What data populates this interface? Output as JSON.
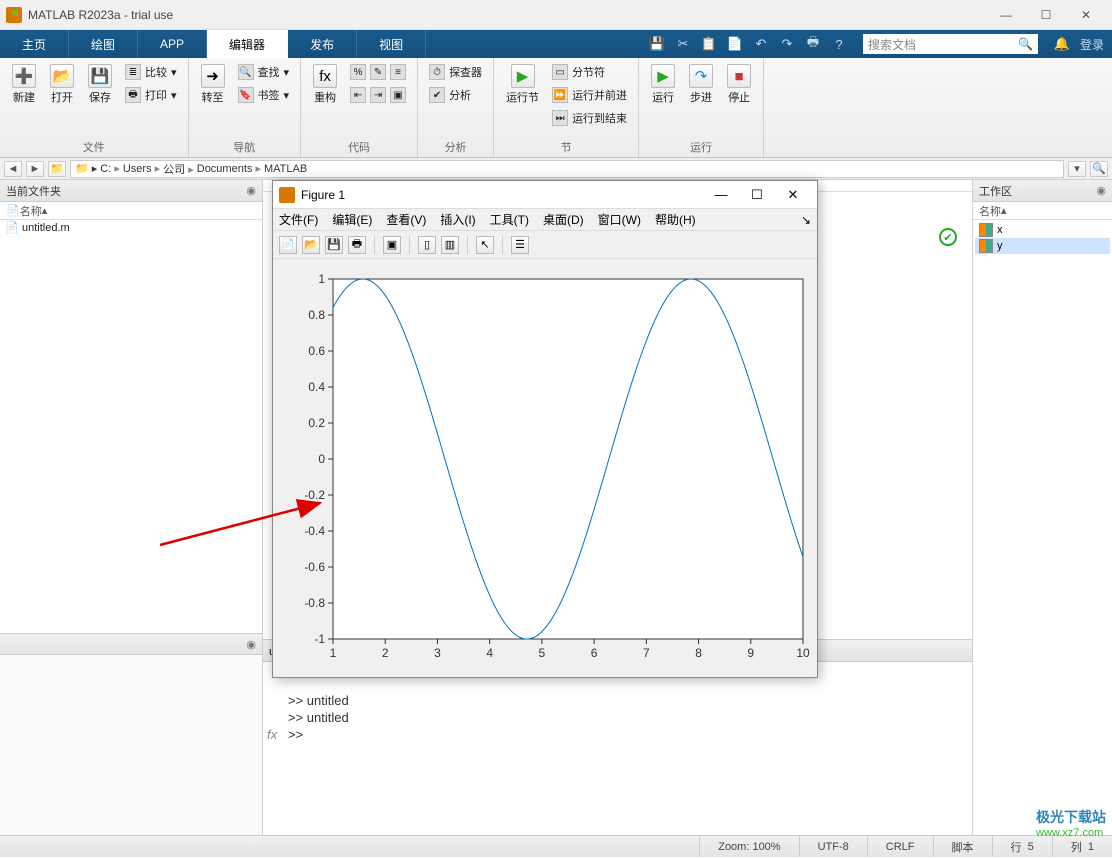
{
  "window": {
    "title": "MATLAB R2023a - trial use"
  },
  "tabs": [
    "主页",
    "绘图",
    "APP",
    "编辑器",
    "发布",
    "视图"
  ],
  "active_tab": 3,
  "qat_search_placeholder": "搜索文档",
  "qat_login": "登录",
  "ribbon": {
    "file": {
      "new": "新建",
      "open": "打开",
      "save": "保存",
      "compare": "比较",
      "print": "打印",
      "label": "文件"
    },
    "nav": {
      "goto": "转至",
      "find": "查找",
      "bookmark": "书签",
      "label": "导航"
    },
    "code": {
      "refactor": "重构",
      "label": "代码"
    },
    "analyze": {
      "explorer": "探查器",
      "analyze": "分析",
      "label": "分析"
    },
    "section": {
      "run": "运行节",
      "sect": "分节符",
      "runadv": "运行并前进",
      "runend": "运行到结束",
      "label": "节"
    },
    "run": {
      "run": "运行",
      "step": "步进",
      "stop": "停止",
      "label": "运行"
    }
  },
  "path": [
    "C:",
    "Users",
    "公司",
    "Documents",
    "MATLAB"
  ],
  "current_folder": {
    "title": "当前文件夹",
    "col": "名称",
    "files": [
      "untitled.m"
    ]
  },
  "editor": {
    "tab": "untitled.m  (脚本)"
  },
  "command": {
    "lines": [
      ">> untitled",
      ">> untitled",
      ">>"
    ]
  },
  "workspace": {
    "title": "工作区",
    "col": "名称",
    "vars": [
      "x",
      "y"
    ]
  },
  "statusbar": {
    "zoom": "Zoom: 100%",
    "enc": "UTF-8",
    "eol": "CRLF",
    "type": "脚本",
    "row": "行",
    "rownum": "5",
    "col": "列",
    "colnum": "1"
  },
  "figure": {
    "title": "Figure 1",
    "menus": [
      "文件(F)",
      "编辑(E)",
      "查看(V)",
      "插入(I)",
      "工具(T)",
      "桌面(D)",
      "窗口(W)",
      "帮助(H)"
    ]
  },
  "chart_data": {
    "type": "line",
    "x": [
      1,
      2,
      3,
      4,
      5,
      6,
      7,
      8,
      9,
      10
    ],
    "y": [
      0.84,
      1.0,
      0.14,
      -0.76,
      -0.96,
      -0.28,
      0.66,
      0.99,
      0.41,
      -0.54
    ],
    "xlim": [
      1,
      10
    ],
    "ylim": [
      -1,
      1
    ],
    "xticks": [
      1,
      2,
      3,
      4,
      5,
      6,
      7,
      8,
      9,
      10
    ],
    "yticks": [
      -1,
      -0.8,
      -0.6,
      -0.4,
      -0.2,
      0,
      0.2,
      0.4,
      0.6,
      0.8,
      1
    ]
  },
  "watermark": {
    "name": "极光下载站",
    "url": "www.xz7.com"
  }
}
